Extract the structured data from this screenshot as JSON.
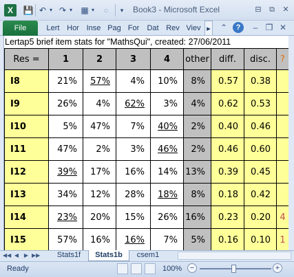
{
  "window": {
    "title": "Book3 - Microsoft Excel",
    "min": "⊟",
    "restore": "⧉",
    "close": "✕"
  },
  "quick_access": {
    "save": "💾",
    "undo": "↶",
    "redo": "↷",
    "form": "▦",
    "circle": "○",
    "more": "▾"
  },
  "ribbon": {
    "file": "File",
    "tabs": [
      "Lert",
      "Hor",
      "Inse",
      "Pag",
      "For",
      "Dat",
      "Rev",
      "Viev"
    ],
    "more": "▸",
    "icons": {
      "expand": "⌃",
      "help": "?",
      "min": "–",
      "restore": "❐",
      "close": "✕"
    }
  },
  "sheet": {
    "banner": "Lertap5 brief item stats for \"MathsQui\", created: 27/06/2011",
    "headers": [
      "Res =",
      "1",
      "2",
      "3",
      "4",
      "other",
      "diff.",
      "disc.",
      "?"
    ],
    "rows": [
      {
        "label": "I8",
        "opts": [
          "21%",
          "57%",
          "4%",
          "10%"
        ],
        "key": 1,
        "other": "8%",
        "diff": "0.57",
        "disc": "0.38",
        "flag": ""
      },
      {
        "label": "I9",
        "opts": [
          "26%",
          "4%",
          "62%",
          "3%"
        ],
        "key": 2,
        "other": "4%",
        "diff": "0.62",
        "disc": "0.53",
        "flag": ""
      },
      {
        "label": "I10",
        "opts": [
          "5%",
          "47%",
          "7%",
          "40%"
        ],
        "key": 3,
        "other": "2%",
        "diff": "0.40",
        "disc": "0.46",
        "flag": ""
      },
      {
        "label": "I11",
        "opts": [
          "47%",
          "2%",
          "3%",
          "46%"
        ],
        "key": 3,
        "other": "2%",
        "diff": "0.46",
        "disc": "0.60",
        "flag": ""
      },
      {
        "label": "I12",
        "opts": [
          "39%",
          "17%",
          "16%",
          "14%"
        ],
        "key": 0,
        "other": "13%",
        "diff": "0.39",
        "disc": "0.45",
        "flag": ""
      },
      {
        "label": "I13",
        "opts": [
          "34%",
          "12%",
          "28%",
          "18%"
        ],
        "key": 3,
        "other": "8%",
        "diff": "0.18",
        "disc": "0.42",
        "flag": ""
      },
      {
        "label": "I14",
        "opts": [
          "23%",
          "20%",
          "15%",
          "26%"
        ],
        "key": 0,
        "other": "16%",
        "diff": "0.23",
        "disc": "0.20",
        "flag": "4"
      },
      {
        "label": "I15",
        "opts": [
          "57%",
          "16%",
          "16%",
          "7%"
        ],
        "key": 2,
        "other": "5%",
        "diff": "0.16",
        "disc": "0.10",
        "flag": "1"
      }
    ]
  },
  "sheet_tabs": {
    "nav": [
      "◀◀",
      "◀",
      "▶",
      "▶▶"
    ],
    "tabs": [
      "Stats1f",
      "Stats1b",
      "csem1"
    ],
    "active": "Stats1b"
  },
  "status": {
    "ready": "Ready",
    "zoom": "100%",
    "minus": "−",
    "plus": "+"
  }
}
